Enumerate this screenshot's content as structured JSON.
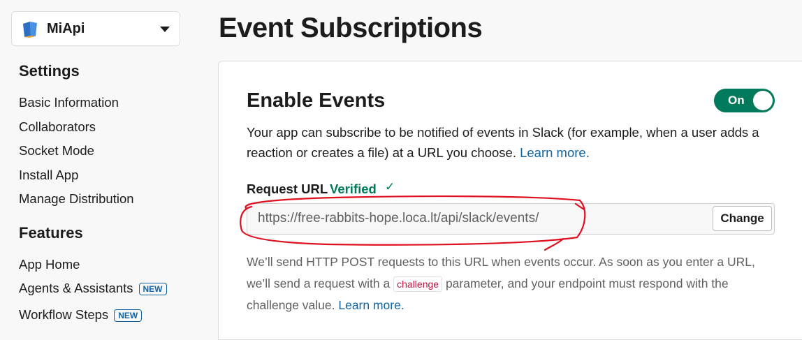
{
  "app": {
    "name": "MiApi",
    "icon": "book-icon"
  },
  "sidebar": {
    "settings_heading": "Settings",
    "settings_items": [
      {
        "label": "Basic Information"
      },
      {
        "label": "Collaborators"
      },
      {
        "label": "Socket Mode"
      },
      {
        "label": "Install App"
      },
      {
        "label": "Manage Distribution"
      }
    ],
    "features_heading": "Features",
    "features_items": [
      {
        "label": "App Home",
        "badge": ""
      },
      {
        "label": "Agents & Assistants",
        "badge": "NEW"
      },
      {
        "label": "Workflow Steps",
        "badge": "NEW"
      }
    ]
  },
  "page": {
    "title": "Event Subscriptions"
  },
  "enable_events": {
    "title": "Enable Events",
    "toggle_label": "On",
    "toggle_state": true,
    "description": "Your app can subscribe to be notified of events in Slack (for example, when a user adds a reaction or creates a file) at a URL you choose.",
    "learn_more": "Learn more."
  },
  "request_url": {
    "label": "Request URL",
    "status": "Verified",
    "status_icon": "checkmark-icon",
    "value": "https://free-rabbits-hope.loca.lt/api/slack/events/",
    "change_label": "Change"
  },
  "help": {
    "part1": "We’ll send HTTP POST requests to this URL when events occur. As soon as you enter a URL, we’ll send a request with a",
    "code": "challenge",
    "part2": "parameter, and your endpoint must respond with the challenge value.",
    "learn_more": "Learn more."
  },
  "colors": {
    "accent_green": "#007a5a",
    "link_blue": "#1264a3",
    "annotation_red": "#e01020"
  }
}
